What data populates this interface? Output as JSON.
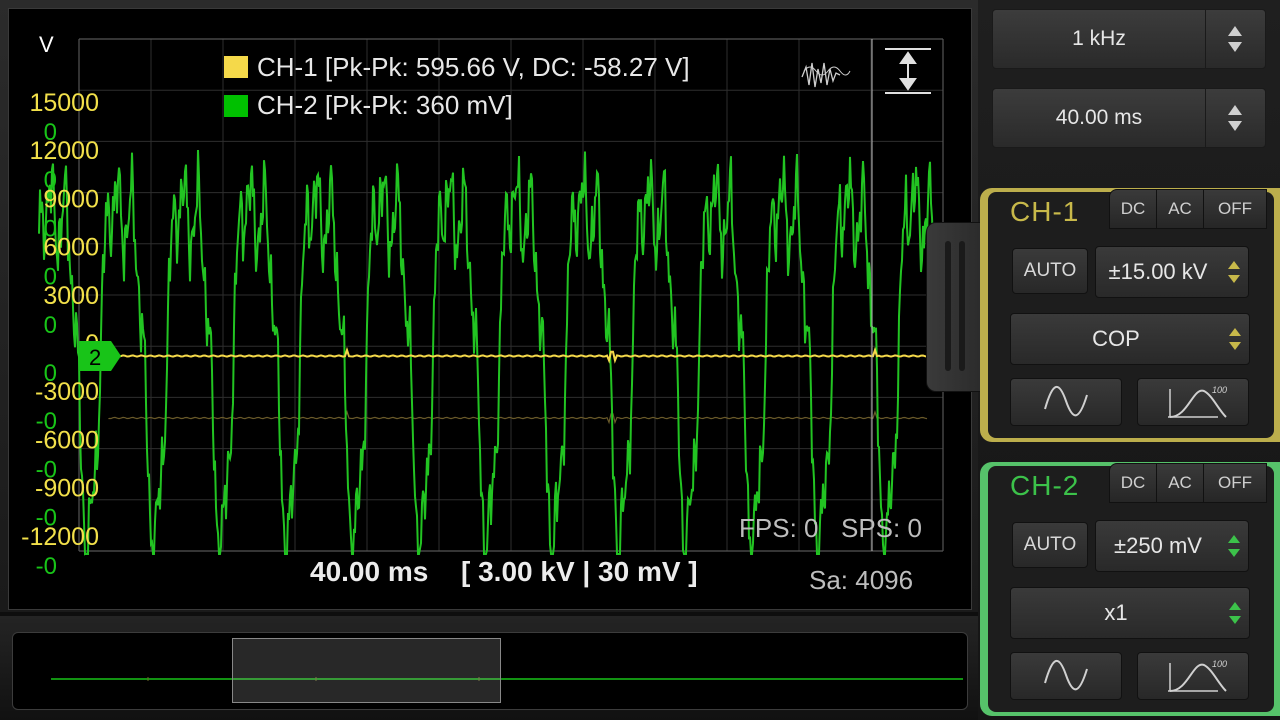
{
  "scope": {
    "y_unit": "V",
    "legend": [
      {
        "text": "CH-1 [Pk-Pk: 595.66 V, DC: -58.27 V]",
        "color": "#f5d94a"
      },
      {
        "text": "CH-2 [Pk-Pk: 360 mV]",
        "color": "#00c000"
      }
    ],
    "ch1_ticks": [
      "15000",
      "12000",
      "9000",
      "6000",
      "3000",
      "0",
      "-3000",
      "-6000",
      "-9000",
      "-12000"
    ],
    "ch2_ticks": [
      "0",
      "0",
      "0",
      "0",
      "0",
      "0",
      "-0",
      "-0",
      "-0",
      "-0"
    ],
    "ch2_marker": "2",
    "fps": "FPS: 0",
    "sps": "SPS: 0",
    "timebase": "40.00 ms",
    "scales": "[ 3.00 kV | 30 mV ]",
    "samples": "Sa: 4096",
    "waveform_icon": "waveform-icon",
    "vertical_scale_icon": "vertical-scale-icon"
  },
  "controls": {
    "frequency": "1 kHz",
    "time_per_div": "40.00 ms"
  },
  "ch1": {
    "label": "CH-1",
    "color": "#c8b94a",
    "coupling": [
      "DC",
      "AC",
      "OFF"
    ],
    "auto": "AUTO",
    "range": "±15.00 kV",
    "probe": "COP"
  },
  "ch2": {
    "label": "CH-2",
    "color": "#3cc24a",
    "coupling": [
      "DC",
      "AC",
      "OFF"
    ],
    "auto": "AUTO",
    "range": "±250 mV",
    "probe": "x1"
  },
  "colors": {
    "grid": "#2e2e2e",
    "ch1_trace": "#f5d94a",
    "ch2_trace": "#22c422",
    "tick_ch1": "#f2e04a",
    "tick_ch2": "#18c418"
  }
}
